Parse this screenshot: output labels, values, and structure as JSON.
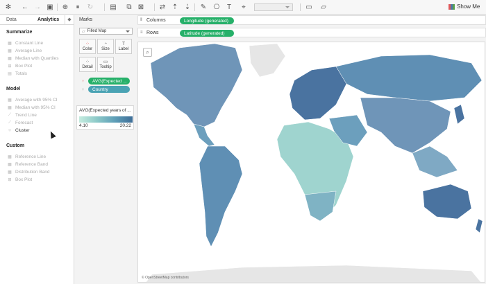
{
  "toolbar": {
    "show_me_label": "Show Me"
  },
  "left_pane": {
    "tabs": {
      "data": "Data",
      "analytics": "Analytics"
    },
    "sections": [
      {
        "title": "Summarize",
        "items": [
          {
            "label": "Constant Line",
            "icon": "reference-line-icon",
            "enabled": false
          },
          {
            "label": "Average Line",
            "icon": "reference-line-icon",
            "enabled": false
          },
          {
            "label": "Median with Quartiles",
            "icon": "reference-band-icon",
            "enabled": false
          },
          {
            "label": "Box Plot",
            "icon": "box-plot-icon",
            "enabled": false
          },
          {
            "label": "Totals",
            "icon": "totals-icon",
            "enabled": false
          }
        ]
      },
      {
        "title": "Model",
        "items": [
          {
            "label": "Average with 95% CI",
            "icon": "confidence-icon",
            "enabled": false
          },
          {
            "label": "Median with 95% CI",
            "icon": "confidence-icon",
            "enabled": false
          },
          {
            "label": "Trend Line",
            "icon": "trend-line-icon",
            "enabled": false
          },
          {
            "label": "Forecast",
            "icon": "forecast-icon",
            "enabled": false
          },
          {
            "label": "Cluster",
            "icon": "cluster-icon",
            "enabled": true
          }
        ]
      },
      {
        "title": "Custom",
        "items": [
          {
            "label": "Reference Line",
            "icon": "reference-line-icon",
            "enabled": false
          },
          {
            "label": "Reference Band",
            "icon": "reference-band-icon",
            "enabled": false
          },
          {
            "label": "Distribution Band",
            "icon": "distribution-band-icon",
            "enabled": false
          },
          {
            "label": "Box Plot",
            "icon": "box-plot-icon",
            "enabled": false
          }
        ]
      }
    ]
  },
  "marks": {
    "title": "Marks",
    "mark_type": "Filled Map",
    "buttons": {
      "color": "Color",
      "size": "Size",
      "label": "Label",
      "detail": "Detail",
      "tooltip": "Tooltip"
    },
    "pills": {
      "color_field": "AVG(Expected ...",
      "detail_field": "Country"
    }
  },
  "legend": {
    "title": "AVG(Expected years of ...",
    "min": "4.10",
    "max": "20.22",
    "colors": [
      "#c5ecdf",
      "#3f6e97"
    ]
  },
  "shelves": {
    "columns": {
      "label": "Columns",
      "pill": "Longitude (generated)"
    },
    "rows": {
      "label": "Rows",
      "pill": "Latitude (generated)"
    }
  },
  "map": {
    "attribution": "© OpenStreetMap contributors"
  },
  "colors": {
    "pill_green": "#26b069",
    "pill_teal": "#4aa3b4",
    "map_light": "#9fd4cf",
    "map_mid": "#6c9fbd",
    "map_dark": "#4a73a0"
  }
}
